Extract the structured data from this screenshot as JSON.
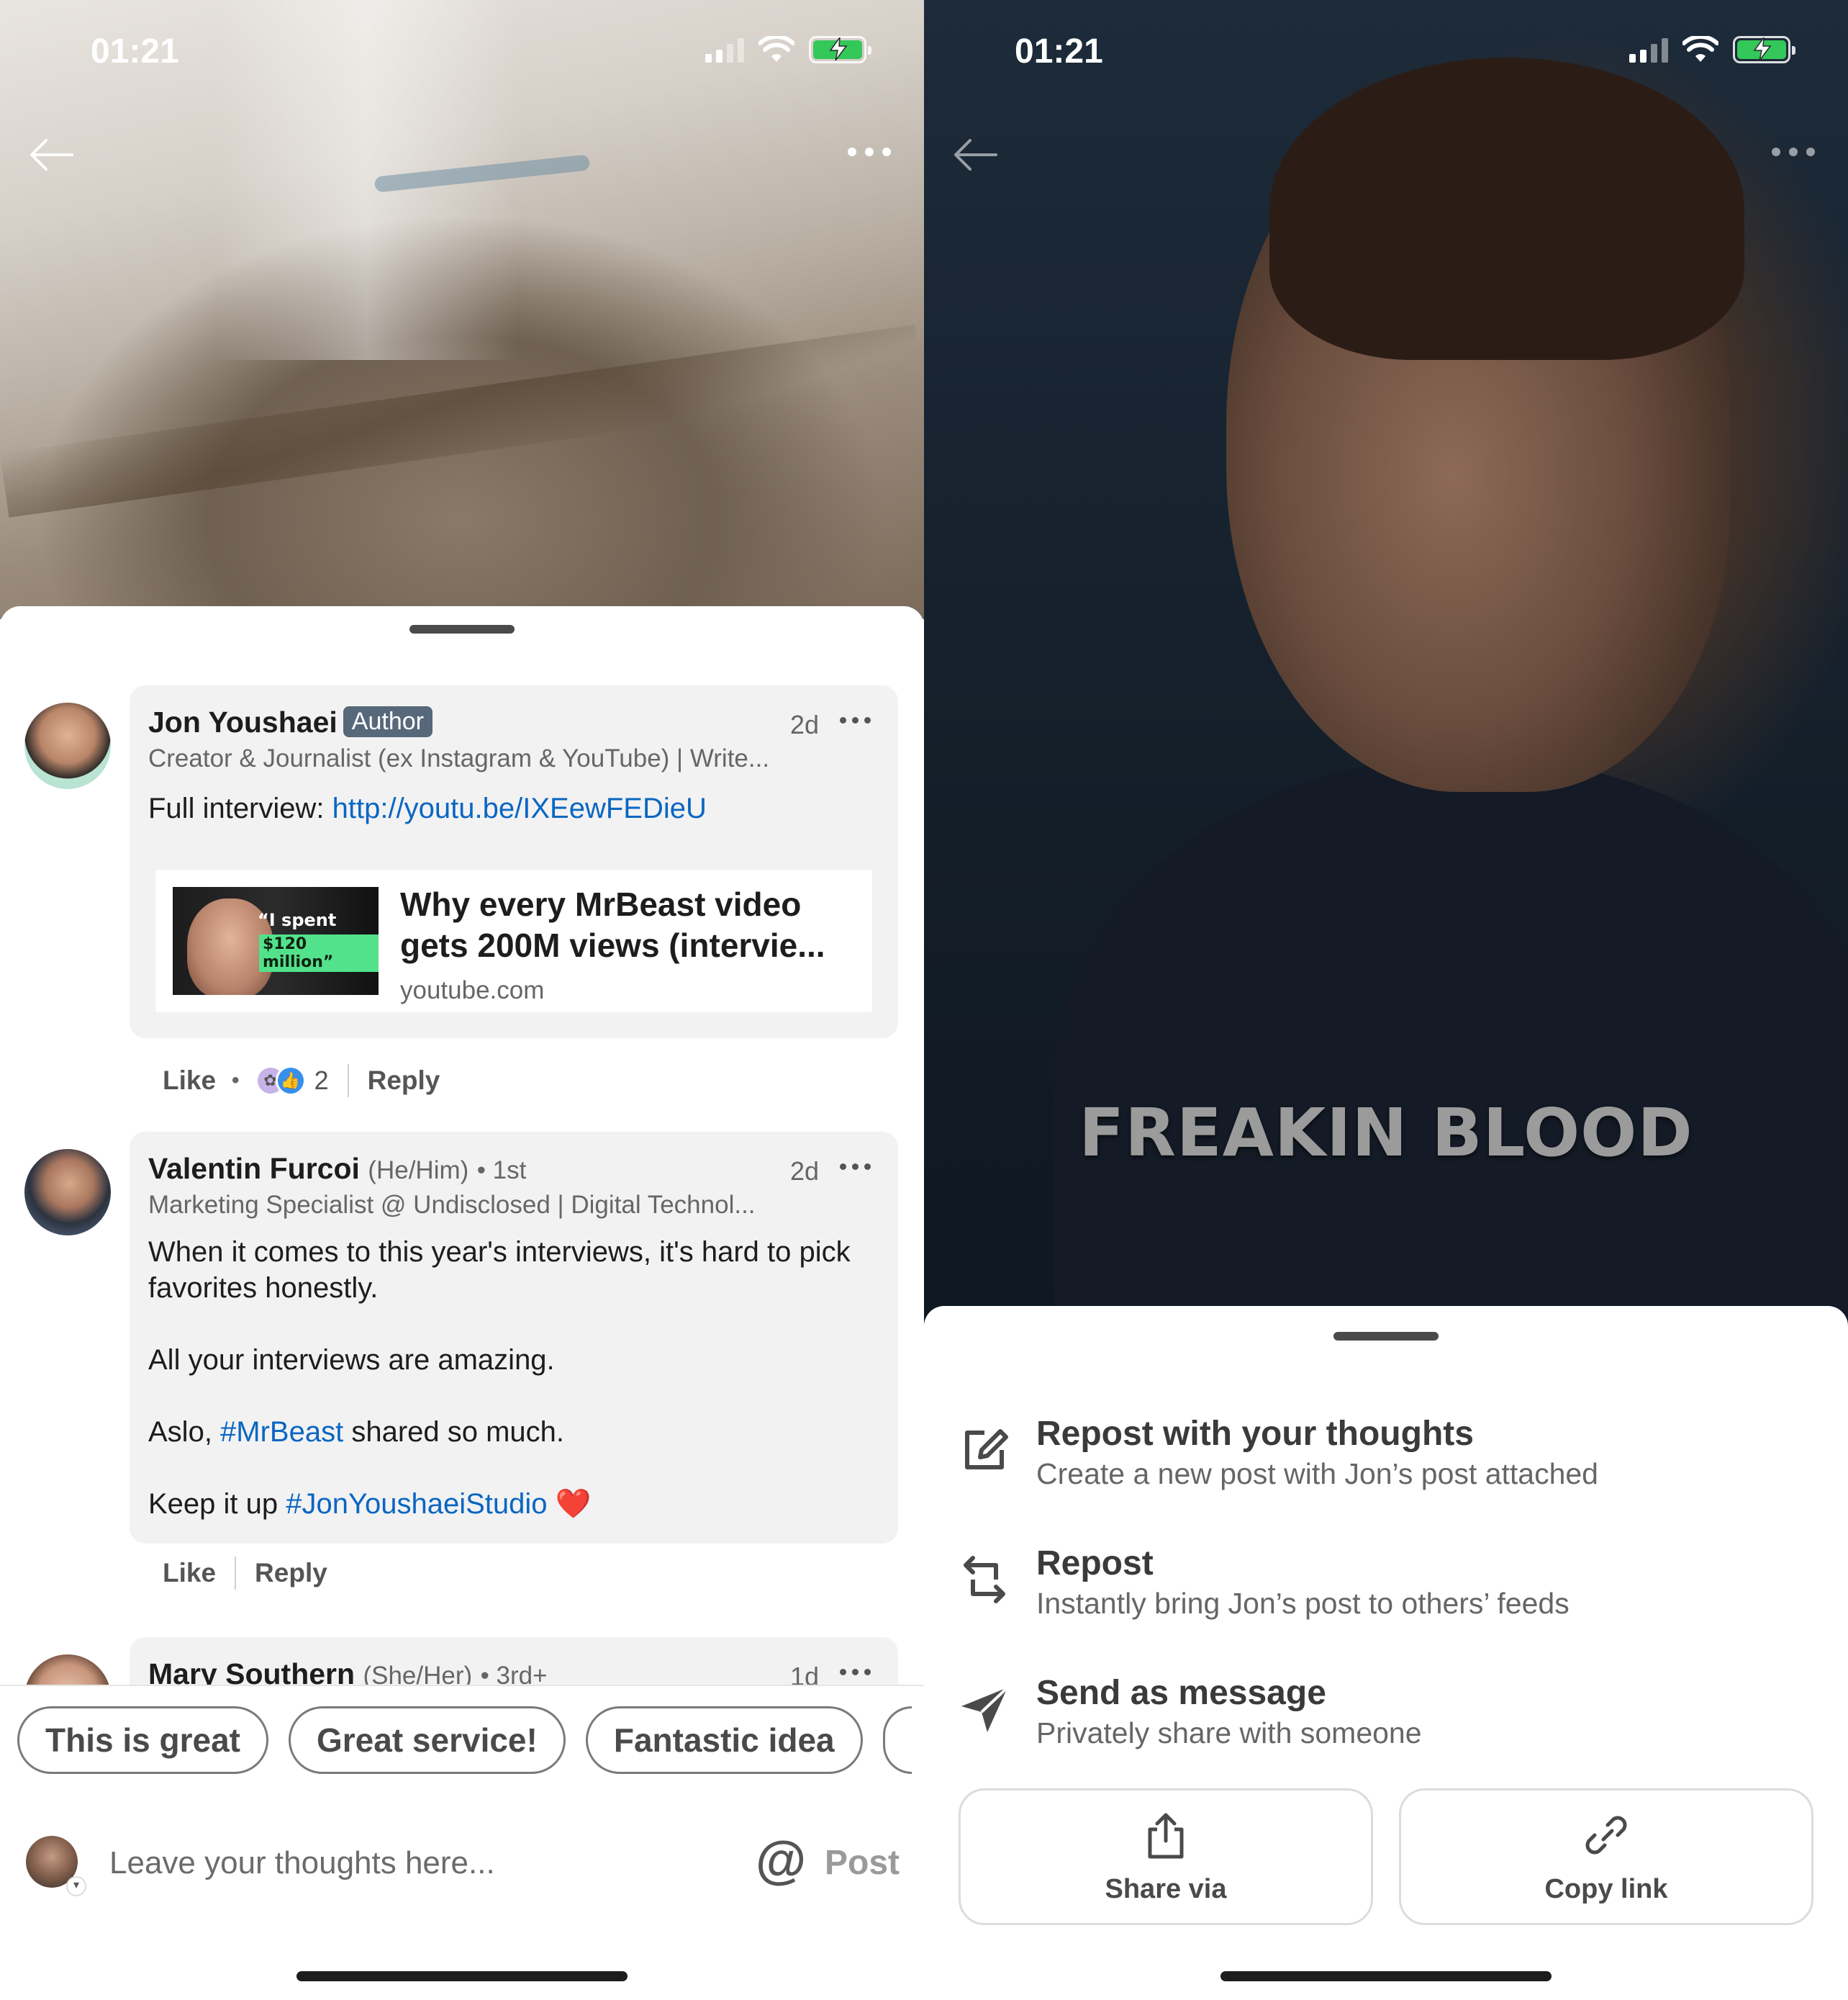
{
  "left": {
    "status": {
      "time": "01:21"
    },
    "comments": [
      {
        "name": "Jon Youshaei",
        "badge": "Author",
        "time": "2d",
        "headline": "Creator & Journalist (ex Instagram & YouTube) | Write...",
        "body_prefix": "Full interview: ",
        "body_link": "http://youtu.be/IXEewFEDieU",
        "card": {
          "title": "Why every MrBeast video gets 200M views (intervie...",
          "domain": "youtube.com",
          "thumb_line1": "“I spent",
          "thumb_line2": "$120 million”"
        },
        "actions": {
          "like": "Like",
          "reaction_count": "2",
          "reply": "Reply"
        }
      },
      {
        "name": "Valentin Furcoi",
        "pronouns": "(He/Him)",
        "degree": "• 1st",
        "time": "2d",
        "headline": "Marketing Specialist @ Undisclosed | Digital Technol...",
        "body_p1": "When it comes to this year's  interviews, it's hard to pick favorites honestly.",
        "body_p2": "All your interviews are amazing.",
        "body_p3_prefix": "Aslo, ",
        "body_p3_tag": "#MrBeast",
        "body_p3_suffix": " shared so much.",
        "body_p4_prefix": "Keep it up ",
        "body_p4_tag": "#JonYoushaeiStudio",
        "body_p4_emoji": "❤️",
        "actions": {
          "like": "Like",
          "reply": "Reply"
        }
      },
      {
        "name": "Mary Southern",
        "pronouns": "(She/Her)",
        "degree": "• 3rd+",
        "time": "1d"
      }
    ],
    "chips": [
      "This is great",
      "Great service!",
      "Fantastic idea"
    ],
    "composer": {
      "placeholder": "Leave your thoughts here...",
      "at": "@",
      "post": "Post"
    }
  },
  "right": {
    "status": {
      "time": "01:21"
    },
    "video_caption": "FREAKIN BLOOD",
    "share_options": [
      {
        "title": "Repost with your thoughts",
        "subtitle": "Create a new post with Jon’s post attached",
        "icon": "edit-icon"
      },
      {
        "title": "Repost",
        "subtitle": "Instantly bring Jon’s post to others’ feeds",
        "icon": "repost-icon"
      },
      {
        "title": "Send as message",
        "subtitle": "Privately share with someone",
        "icon": "send-icon"
      }
    ],
    "buttons": {
      "share_via": "Share via",
      "copy_link": "Copy link"
    }
  },
  "colors": {
    "link": "#0a66c2",
    "author_badge": "#56687a",
    "battery": "#34c759",
    "like_blue": "#378fe9"
  }
}
